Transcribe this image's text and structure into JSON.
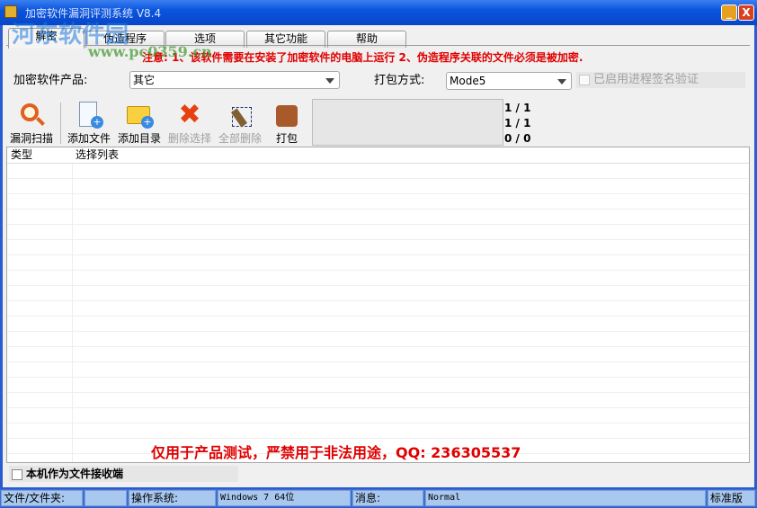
{
  "window": {
    "title": "加密软件漏洞评测系统  V8.4",
    "minimize": "_",
    "close": "X"
  },
  "watermark": {
    "name": "河东软件园",
    "url": "www.pc0359.cn"
  },
  "tabs": [
    {
      "label": "解密"
    },
    {
      "label": "伪造程序"
    },
    {
      "label": "选项"
    },
    {
      "label": "其它功能"
    },
    {
      "label": "帮助"
    }
  ],
  "notice": "注意: 1、该软件需要在安装了加密软件的电脑上运行  2、伪造程序关联的文件必须是被加密.",
  "product": {
    "label": "加密软件产品:",
    "value": "其它"
  },
  "pack": {
    "label": "打包方式:",
    "value": "Mode5"
  },
  "sign_check": {
    "label": "已启用进程签名验证",
    "checked": false,
    "enabled": false
  },
  "toolbar": {
    "scan": "漏洞扫描",
    "add_file": "添加文件",
    "add_dir": "添加目录",
    "delete_sel": "删除选择",
    "delete_all": "全部删除",
    "pack": "打包"
  },
  "counts": [
    "1 / 1",
    "1 / 1",
    "0 / 0"
  ],
  "list": {
    "columns": [
      "类型",
      "选择列表"
    ],
    "rows": []
  },
  "warning": "仅用于产品测试，严禁用于非法用途，QQ: 236305537",
  "receiver": {
    "label": "本机作为文件接收端",
    "checked": false
  },
  "status": {
    "file_label": "文件/文件夹:",
    "file_value": "",
    "os_label": "操作系统:",
    "os_value": "Windows 7 64位",
    "msg_label": "消息:",
    "msg_value": "Normal",
    "edition": "标准版"
  }
}
